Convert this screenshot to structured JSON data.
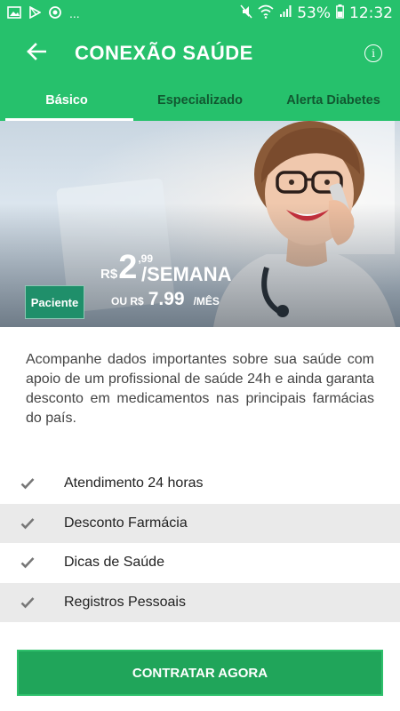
{
  "status_bar": {
    "more": "...",
    "battery": "53%",
    "time": "12:32"
  },
  "app_bar": {
    "title": "CONEXÃO SAÚDE"
  },
  "tabs": [
    {
      "label": "Básico",
      "active": true
    },
    {
      "label": "Especializado",
      "active": false
    },
    {
      "label": "Alerta Diabetes",
      "active": false
    }
  ],
  "hero": {
    "badge": "Paciente",
    "price_currency": "R$",
    "price_integer": "2",
    "price_decimal": ",99",
    "price_period": "/SEMANA",
    "alt_prefix": "OU R$",
    "alt_value": "7.99",
    "alt_period": "/MÊS"
  },
  "description": "Acompanhe dados importantes sobre sua saúde com apoio de um profissional de saúde 24h e ainda garanta desconto em medicamentos nas principais farmácias do país.",
  "features": [
    {
      "label": "Atendimento 24 horas"
    },
    {
      "label": "Desconto Farmácia"
    },
    {
      "label": "Dicas de Saúde"
    },
    {
      "label": "Registros Pessoais"
    }
  ],
  "cta": {
    "label": "CONTRATAR AGORA"
  },
  "colors": {
    "primary": "#26c16c",
    "button": "#20a55a",
    "badge": "#1f8f6a"
  }
}
